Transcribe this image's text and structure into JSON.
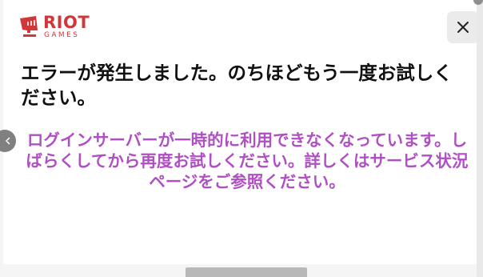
{
  "logo": {
    "brand_top": "RIOT",
    "brand_bottom": "GAMES",
    "color": "#d13639",
    "icon": "riot-fist-icon"
  },
  "dialog": {
    "close_icon": "close-icon",
    "title": "エラーが発生しました。のちほどもう一度お試しください。",
    "message": "ログインサーバーが一時的に利用できなくなっています。しばらくしてから再度お試しください。詳しくはサービス状況ページをご参照ください。",
    "message_color": "#b04fc4"
  },
  "side_tab": {
    "icon": "chevron-left-icon"
  }
}
